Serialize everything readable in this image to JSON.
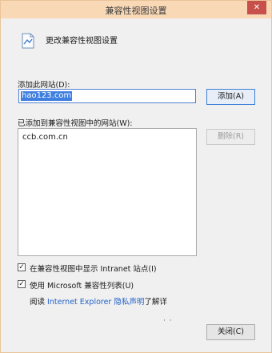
{
  "window": {
    "title": "兼容性视图设置",
    "close_glyph": "✕"
  },
  "header": {
    "text": "更改兼容性视图设置",
    "icon": "settings-page-icon"
  },
  "add_site": {
    "label": "添加此网站(D):",
    "value": "hao123.com",
    "add_button": "添加(A)"
  },
  "sites_list": {
    "label": "已添加到兼容性视图中的网站(W):",
    "items": [
      "ccb.com.cn"
    ],
    "remove_button": "删除(R)"
  },
  "options": {
    "intranet": {
      "label": "在兼容性视图中显示 Intranet 站点(I)",
      "checked": true
    },
    "ms_list": {
      "label": "使用 Microsoft 兼容性列表(U)",
      "checked": true
    }
  },
  "footer": {
    "read_prefix": "阅读",
    "privacy_link": "Internet Explorer 隐私声明",
    "read_suffix": "了解详",
    "close_button": "关闭(C)"
  }
}
